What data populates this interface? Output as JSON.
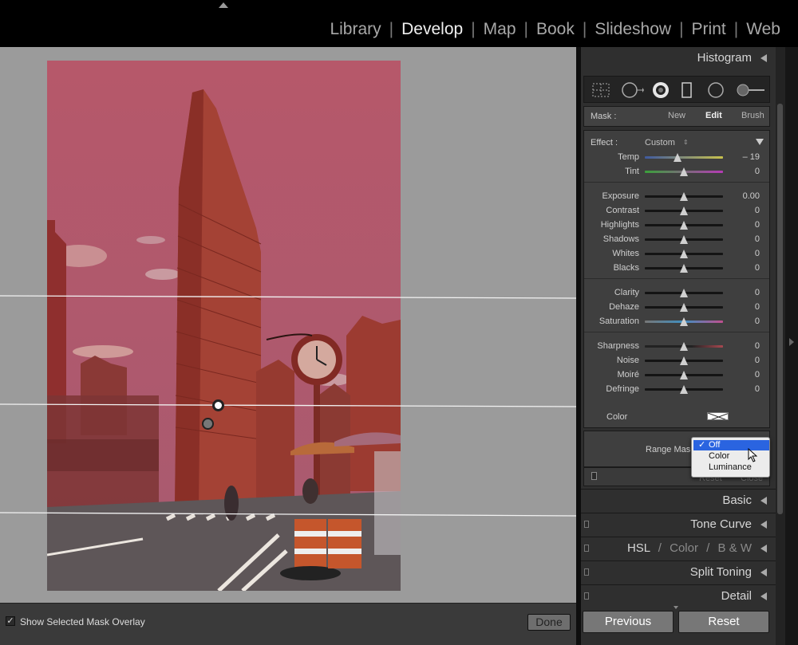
{
  "modules": [
    {
      "label": "Library",
      "active": false
    },
    {
      "label": "Develop",
      "active": true
    },
    {
      "label": "Map",
      "active": false
    },
    {
      "label": "Book",
      "active": false
    },
    {
      "label": "Slideshow",
      "active": false
    },
    {
      "label": "Print",
      "active": false
    },
    {
      "label": "Web",
      "active": false
    }
  ],
  "module_separator": "|",
  "toolbar": {
    "overlay_checked": true,
    "overlay_check_glyph": "✓",
    "overlay_label": "Show Selected Mask Overlay",
    "done_label": "Done"
  },
  "panel": {
    "histogram_title": "Histogram",
    "tools": [
      "crop-overlay-icon",
      "spot-removal-icon",
      "red-eye-icon",
      "graduated-filter-icon",
      "radial-filter-icon",
      "adjustment-brush-icon"
    ],
    "mask": {
      "label": "Mask :",
      "new": "New",
      "edit": "Edit",
      "brush": "Brush",
      "active": "Edit"
    },
    "effect": {
      "label": "Effect :",
      "value": "Custom",
      "up_down_glyph": "⇕",
      "groups": [
        [
          {
            "label": "Temp",
            "value": "– 19",
            "level": 0.42
          },
          {
            "label": "Tint",
            "value": "0",
            "level": 0.5
          }
        ],
        [
          {
            "label": "Exposure",
            "value": "0.00",
            "level": 0.5
          },
          {
            "label": "Contrast",
            "value": "0",
            "level": 0.5
          },
          {
            "label": "Highlights",
            "value": "0",
            "level": 0.5
          },
          {
            "label": "Shadows",
            "value": "0",
            "level": 0.5
          },
          {
            "label": "Whites",
            "value": "0",
            "level": 0.5
          },
          {
            "label": "Blacks",
            "value": "0",
            "level": 0.5
          }
        ],
        [
          {
            "label": "Clarity",
            "value": "0",
            "level": 0.5
          },
          {
            "label": "Dehaze",
            "value": "0",
            "level": 0.5
          },
          {
            "label": "Saturation",
            "value": "0",
            "level": 0.5
          }
        ],
        [
          {
            "label": "Sharpness",
            "value": "0",
            "level": 0.5
          },
          {
            "label": "Noise",
            "value": "0",
            "level": 0.5
          },
          {
            "label": "Moiré",
            "value": "0",
            "level": 0.5
          },
          {
            "label": "Defringe",
            "value": "0",
            "level": 0.5
          }
        ]
      ],
      "color_label": "Color"
    },
    "range_mask": {
      "label": "Range Mask",
      "options": [
        "Off",
        "Color",
        "Luminance"
      ],
      "selected": "Off",
      "check_glyph": "✓",
      "reset": "Reset",
      "close": "Close"
    },
    "sections": {
      "basic": "Basic",
      "tone_curve": "Tone Curve",
      "hsl": "HSL",
      "color": "Color",
      "bw": "B & W",
      "hsl_sep": "/",
      "split_toning": "Split Toning",
      "detail": "Detail"
    },
    "previous_label": "Previous",
    "reset_label": "Reset"
  },
  "colors": {
    "mask_overlay": "#c8323c",
    "dropdown_highlight": "#2a64e0",
    "canvas_bg": "#9b9b9b",
    "panel_bg": "#2f2f2f"
  }
}
